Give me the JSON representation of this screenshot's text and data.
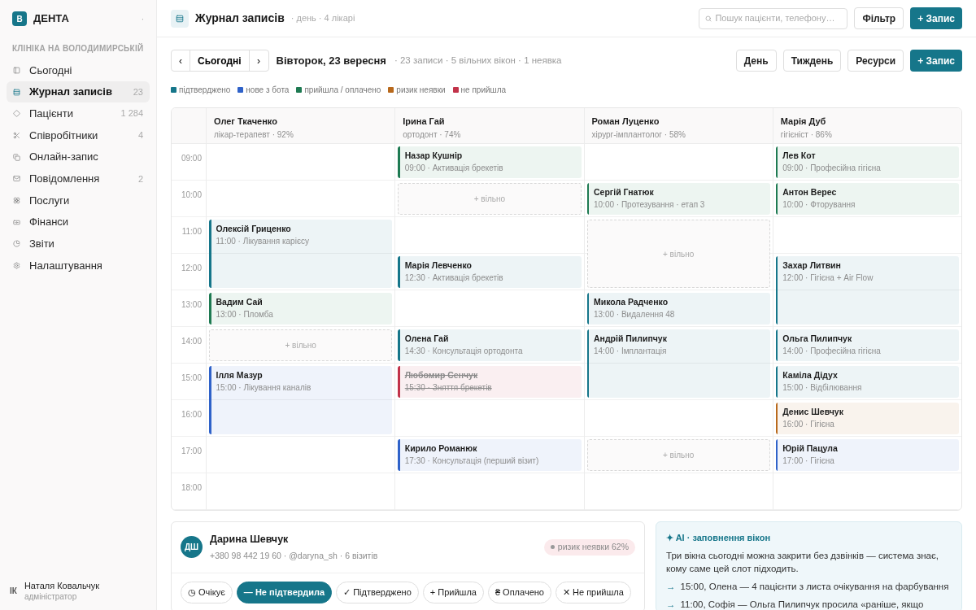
{
  "brand": {
    "logo": "В",
    "name": "ДЕНТА",
    "caret": "·"
  },
  "sidebar": {
    "section": "КЛІНІКА НА ВОЛОДИМИРСЬКІЙ",
    "items": [
      {
        "label": "Сьогодні",
        "selected": false
      },
      {
        "label": "Журнал записів",
        "count": "23",
        "selected": true
      },
      {
        "label": "Пацієнти",
        "count": "1 284",
        "selected": false
      },
      {
        "label": "Співробітники",
        "count": "4",
        "selected": false
      },
      {
        "label": "Онлайн-запис",
        "selected": false
      },
      {
        "label": "Повідомлення",
        "count": "2",
        "selected": false
      },
      {
        "label": "Послуги",
        "selected": false
      },
      {
        "label": "Фінанси",
        "selected": false
      },
      {
        "label": "Звіти",
        "selected": false
      },
      {
        "label": "Налаштування",
        "selected": false
      }
    ],
    "user": {
      "initials": "ІК",
      "name": "Наталя Ковальчук",
      "role": "адміністратор"
    }
  },
  "header": {
    "title": "Журнал записів",
    "subtitle": "· день · 4 лікарі",
    "search": {
      "placeholder": "Пошук пацієнти, телефону…"
    },
    "filter": "Фільтр",
    "add": "+ Запис"
  },
  "toolbar": {
    "prev": "‹",
    "today": "Сьогодні",
    "next": "›",
    "date": "Вівторок, 23 вересня",
    "stats": "· 23 записи · 5 вільних вікон · 1 неявка",
    "views": [
      "День",
      "Тиждень",
      "Ресурси"
    ],
    "add": "+ Запис"
  },
  "legend": [
    {
      "label": "підтверджено",
      "color": "#16768a"
    },
    {
      "label": "нове з бота",
      "color": "#2f62c9"
    },
    {
      "label": "прийшла / оплачено",
      "color": "#1e7a52"
    },
    {
      "label": "ризик неявки",
      "color": "#b8691c"
    },
    {
      "label": "не прийшла",
      "color": "#c2334a"
    }
  ],
  "hours": [
    "09:00",
    "10:00",
    "11:00",
    "12:00",
    "13:00",
    "14:00",
    "15:00",
    "16:00",
    "17:00",
    "18:00"
  ],
  "doctors": [
    {
      "name": "Олег Ткаченко",
      "role": "лікар-терапевт · 92%",
      "blocks": [
        {
          "kind": "empty"
        },
        {
          "kind": "empty"
        },
        {
          "kind": "appointment",
          "patient": "Олексій Гриценко",
          "details": "11:00 · Лікування карієсу",
          "color": "#16768a",
          "long": true,
          "cancelled": false
        },
        {
          "kind": "appointment",
          "patient": "Вадим Сай",
          "details": "13:00 · Пломба",
          "color": "#1e7a52",
          "long": false,
          "cancelled": false
        },
        {
          "kind": "free",
          "label": "+ вільно",
          "long": false
        },
        {
          "kind": "appointment",
          "patient": "Ілля Мазур",
          "details": "15:00 · Лікування каналів",
          "color": "#2f62c9",
          "long": true,
          "cancelled": false
        },
        {
          "kind": "empty"
        },
        {
          "kind": "empty"
        }
      ]
    },
    {
      "name": "Ірина Гай",
      "role": "ортодонт · 74%",
      "blocks": [
        {
          "kind": "appointment",
          "patient": "Назар Кушнір",
          "details": "09:00 · Активація брекетів",
          "color": "#1e7a52",
          "long": false,
          "cancelled": false
        },
        {
          "kind": "free",
          "label": "+ вільно",
          "long": false
        },
        {
          "kind": "empty"
        },
        {
          "kind": "appointment",
          "patient": "Марія Левченко",
          "details": "12:30 · Активація брекетів",
          "color": "#16768a",
          "long": false,
          "cancelled": false
        },
        {
          "kind": "empty"
        },
        {
          "kind": "appointment",
          "patient": "Олена Гай",
          "details": "14:30 · Консультація ортодонта",
          "color": "#16768a",
          "long": false,
          "cancelled": false
        },
        {
          "kind": "appointment",
          "patient": "Любомир Сенчук",
          "details": "15:30 · Зняття брекетів",
          "color": "#c2334a",
          "long": false,
          "cancelled": true
        },
        {
          "kind": "empty"
        },
        {
          "kind": "appointment",
          "patient": "Кирило Романюк",
          "details": "17:30 · Консультація (перший візит)",
          "color": "#2f62c9",
          "long": false,
          "cancelled": false
        },
        {
          "kind": "empty"
        }
      ]
    },
    {
      "name": "Роман Луценко",
      "role": "хірург-імплантолог · 58%",
      "blocks": [
        {
          "kind": "empty"
        },
        {
          "kind": "appointment",
          "patient": "Сергій Гнатюк",
          "details": "10:00 · Протезування · етап 3",
          "color": "#1e7a52",
          "long": false,
          "cancelled": false
        },
        {
          "kind": "free",
          "label": "+ вільно",
          "long": true
        },
        {
          "kind": "appointment",
          "patient": "Микола Радченко",
          "details": "13:00 · Видалення 48",
          "color": "#16768a",
          "long": false,
          "cancelled": false
        },
        {
          "kind": "appointment",
          "patient": "Андрій Пилипчук",
          "details": "14:00 · Імплантація",
          "color": "#16768a",
          "long": true,
          "cancelled": false
        },
        {
          "kind": "empty"
        },
        {
          "kind": "free",
          "label": "+ вільно",
          "long": false
        },
        {
          "kind": "empty"
        }
      ]
    },
    {
      "name": "Марія Дуб",
      "role": "гігієніст · 86%",
      "blocks": [
        {
          "kind": "appointment",
          "patient": "Лев Кот",
          "details": "09:00 · Професійна гігієна",
          "color": "#1e7a52",
          "long": false,
          "cancelled": false
        },
        {
          "kind": "appointment",
          "patient": "Антон Верес",
          "details": "10:00 · Фторування",
          "color": "#1e7a52",
          "long": false,
          "cancelled": false
        },
        {
          "kind": "empty"
        },
        {
          "kind": "appointment",
          "patient": "Захар Литвин",
          "details": "12:00 · Гігієна + Air Flow",
          "color": "#16768a",
          "long": true,
          "cancelled": false
        },
        {
          "kind": "appointment",
          "patient": "Ольга Пилипчук",
          "details": "14:00 · Професійна гігієна",
          "color": "#16768a",
          "long": false,
          "cancelled": false
        },
        {
          "kind": "appointment",
          "patient": "Каміла Дідух",
          "details": "15:00 · Відбілювання",
          "color": "#16768a",
          "long": false,
          "cancelled": false
        },
        {
          "kind": "appointment",
          "patient": "Денис Шевчук",
          "details": "16:00 · Гігієна",
          "color": "#b8691c",
          "long": false,
          "cancelled": false
        },
        {
          "kind": "appointment",
          "patient": "Юрій Пацула",
          "details": "17:00 · Гігієна",
          "color": "#2f62c9",
          "long": false,
          "cancelled": false
        },
        {
          "kind": "empty"
        }
      ]
    }
  ],
  "patient": {
    "initials": "ДШ",
    "name": "Дарина Шевчук",
    "contact": "+380 98 442 19 60 · @daryna_sh · 6 візитів",
    "risk": "ризик неявки 62%",
    "statuses": [
      {
        "label": "◷ Очікує",
        "selected": false
      },
      {
        "label": "— Не підтвердила",
        "selected": true
      },
      {
        "label": "✓ Підтверджено",
        "selected": false
      },
      {
        "label": "+ Прийшла",
        "selected": false
      },
      {
        "label": "₴ Оплачено",
        "selected": false
      },
      {
        "label": "✕ Не прийшла",
        "selected": false
      }
    ]
  },
  "ai": {
    "title": "✦ AI · заповнення вікон",
    "text": "Три вікна сьогодні можна закрити без дзвінків — система знає, кому саме цей слот підходить.",
    "suggestions": [
      {
        "arrow": "→",
        "text": "15:00, Олена — 4 пацієнти з листа очікування на фарбування"
      },
      {
        "arrow": "→",
        "text": "11:00, Софія — Ольга Пилипчук просила «раніше, якщо"
      }
    ]
  }
}
